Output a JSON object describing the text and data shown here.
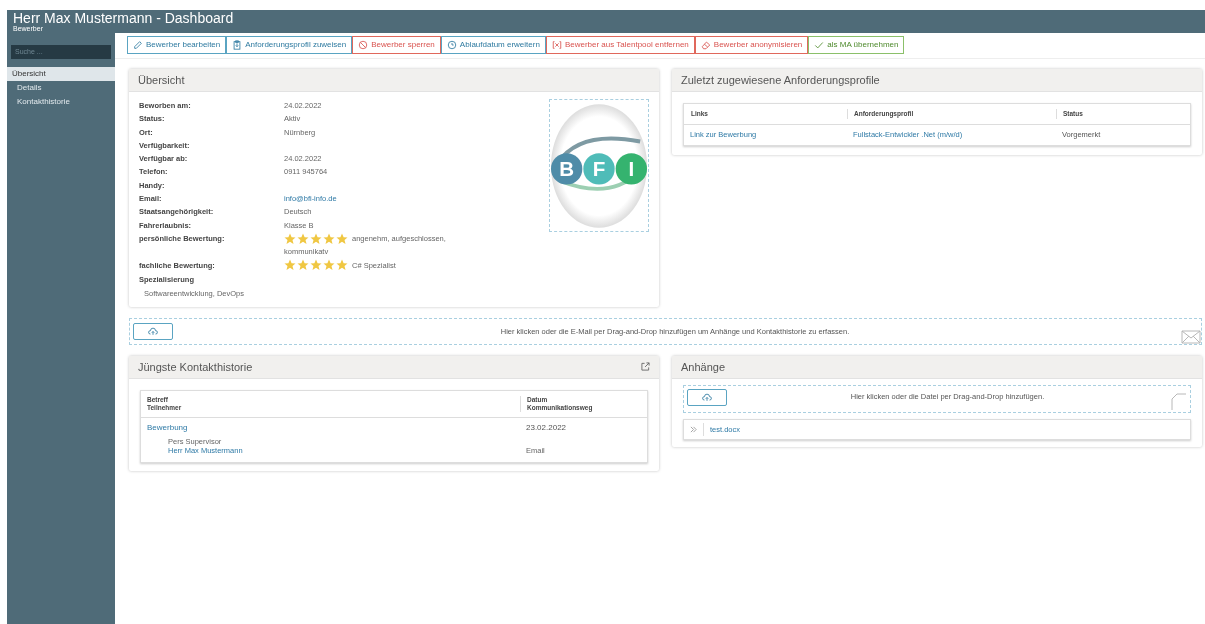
{
  "window": {
    "title": "Herr Max Mustermann - Dashboard",
    "subtitle": "Bewerber"
  },
  "sidebar": {
    "search": {
      "placeholder": "Suche ..."
    },
    "items": [
      {
        "label": "Übersicht",
        "selected": true
      },
      {
        "label": "Details",
        "selected": false
      },
      {
        "label": "Kontakthistorie",
        "selected": false
      }
    ]
  },
  "toolbar": [
    {
      "label": "Bewerber bearbeiten",
      "kind": "primary"
    },
    {
      "label": "Anforderungsprofil zuweisen",
      "kind": "primary"
    },
    {
      "label": "Bewerber sperren",
      "kind": "danger"
    },
    {
      "label": "Ablaufdatum erweitern",
      "kind": "primary"
    },
    {
      "label": "Bewerber aus Talentpool entfernen",
      "kind": "danger"
    },
    {
      "label": "Bewerber anonymisieren",
      "kind": "danger"
    },
    {
      "label": "als MA übernehmen",
      "kind": "success"
    }
  ],
  "overview": {
    "title": "Übersicht",
    "fields": [
      {
        "label": "Beworben am:",
        "value": "24.02.2022"
      },
      {
        "label": "Status:",
        "value": "Aktiv"
      },
      {
        "label": "Ort:",
        "value": "Nürnberg"
      },
      {
        "label": "Verfügbarkeit:"
      },
      {
        "label": "Verfügbar ab:",
        "value": "24.02.2022"
      },
      {
        "label": "Telefon:",
        "value": "0911 945764"
      },
      {
        "label": "Handy:"
      },
      {
        "label": "Email:",
        "value": "info@bfi-info.de",
        "kind": "link"
      },
      {
        "label": "Staatsangehörigkeit:",
        "value": "Deutsch"
      },
      {
        "label": "Fahrerlaubnis:",
        "value": "Klasse B"
      },
      {
        "label": "persönliche Bewertung:",
        "kind": "rating",
        "stars": 5,
        "value": "angenehm, aufgeschlossen,",
        "continuation": "kommunikatv"
      },
      {
        "label": "fachliche Bewertung:",
        "kind": "rating",
        "stars": 5,
        "value": "C# Spezialist"
      }
    ],
    "specialization": {
      "label": "Spezialisierung",
      "value": "Softwareentwicklung, DevOps"
    },
    "logo": {
      "letters": [
        "B",
        "F",
        "I"
      ]
    }
  },
  "profiles": {
    "title": "Zuletzt zugewiesene Anforderungsprofile",
    "columns": [
      "Links",
      "Anforderungsprofil",
      "Status"
    ],
    "rows": [
      [
        "Link zur Bewerbung",
        "Fullstack-Entwickler .Net (m/w/d)",
        "Vorgemerkt"
      ]
    ]
  },
  "mail_drop": {
    "text": "Hier klicken oder die E-Mail per Drag-and-Drop hinzufügen um Anhänge und Kontakthistorie zu erfassen."
  },
  "contact_history": {
    "title": "Jüngste Kontakthistorie",
    "columns": [
      [
        "Betreff",
        "Teilnehmer"
      ],
      [
        "Datum",
        "Kommunikationsweg"
      ]
    ],
    "rows": [
      {
        "subject": "Bewerbung",
        "date": "23.02.2022",
        "participants": [
          "Pers Supervisor",
          "Herr Max Mustermann"
        ],
        "channel": "Email"
      }
    ]
  },
  "attachments": {
    "title": "Anhänge",
    "drop_text": "Hier klicken oder die Datei per Drag-and-Drop hinzufügen.",
    "files": [
      "test.docx"
    ]
  }
}
